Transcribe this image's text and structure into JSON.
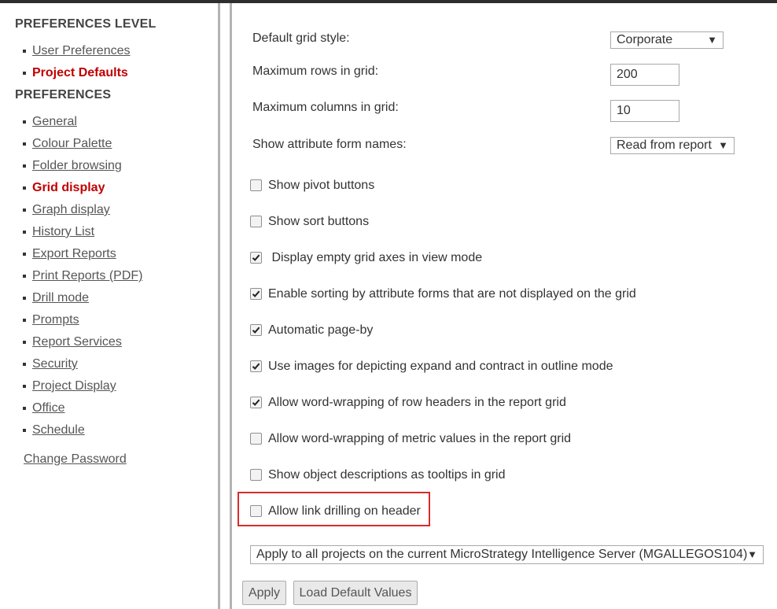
{
  "sidebar": {
    "preferences_level_title": "PREFERENCES LEVEL",
    "level_items": [
      {
        "label": "User Preferences",
        "active": false
      },
      {
        "label": "Project Defaults",
        "active": true
      }
    ],
    "preferences_title": "PREFERENCES",
    "preference_items": [
      {
        "label": "General"
      },
      {
        "label": "Colour Palette"
      },
      {
        "label": "Folder browsing"
      },
      {
        "label": "Grid display"
      },
      {
        "label": "Graph display"
      },
      {
        "label": "History List"
      },
      {
        "label": "Export Reports"
      },
      {
        "label": "Print Reports (PDF)"
      },
      {
        "label": "Drill mode"
      },
      {
        "label": "Prompts"
      },
      {
        "label": "Report Services"
      },
      {
        "label": "Security"
      },
      {
        "label": "Project Display"
      },
      {
        "label": "Office"
      },
      {
        "label": "Schedule"
      }
    ],
    "active_preference": "Grid display",
    "change_password": "Change Password"
  },
  "main": {
    "fields": {
      "grid_style": {
        "label": "Default grid style:",
        "value": "Corporate"
      },
      "max_rows": {
        "label": "Maximum rows in grid:",
        "value": "200"
      },
      "max_cols": {
        "label": "Maximum columns in grid:",
        "value": "10"
      },
      "attr_form_names": {
        "label": "Show attribute form names:",
        "value": "Read from report"
      }
    },
    "checkboxes": [
      {
        "label": "Show pivot buttons",
        "checked": false
      },
      {
        "label": "Show sort buttons",
        "checked": false
      },
      {
        "label": " Display empty grid axes in view mode",
        "checked": true
      },
      {
        "label": "Enable sorting by attribute forms that are not displayed on the grid",
        "checked": true
      },
      {
        "label": "Automatic page-by",
        "checked": true
      },
      {
        "label": "Use images for depicting expand and contract in outline mode",
        "checked": true
      },
      {
        "label": "Allow word-wrapping of row headers in the report grid",
        "checked": true
      },
      {
        "label": "Allow word-wrapping of metric values in the report grid",
        "checked": false
      },
      {
        "label": "Show object descriptions as tooltips in grid",
        "checked": false
      },
      {
        "label": "Allow link drilling on header",
        "checked": false,
        "highlighted": true
      }
    ],
    "apply_scope": "Apply to all projects on the current MicroStrategy Intelligence Server (MGALLEGOS104)",
    "buttons": {
      "apply": "Apply",
      "load_defaults": "Load Default Values"
    }
  },
  "colors": {
    "active_link": "#c00000",
    "highlight_border": "#d92b2b",
    "separator": "#b3b3b3"
  }
}
